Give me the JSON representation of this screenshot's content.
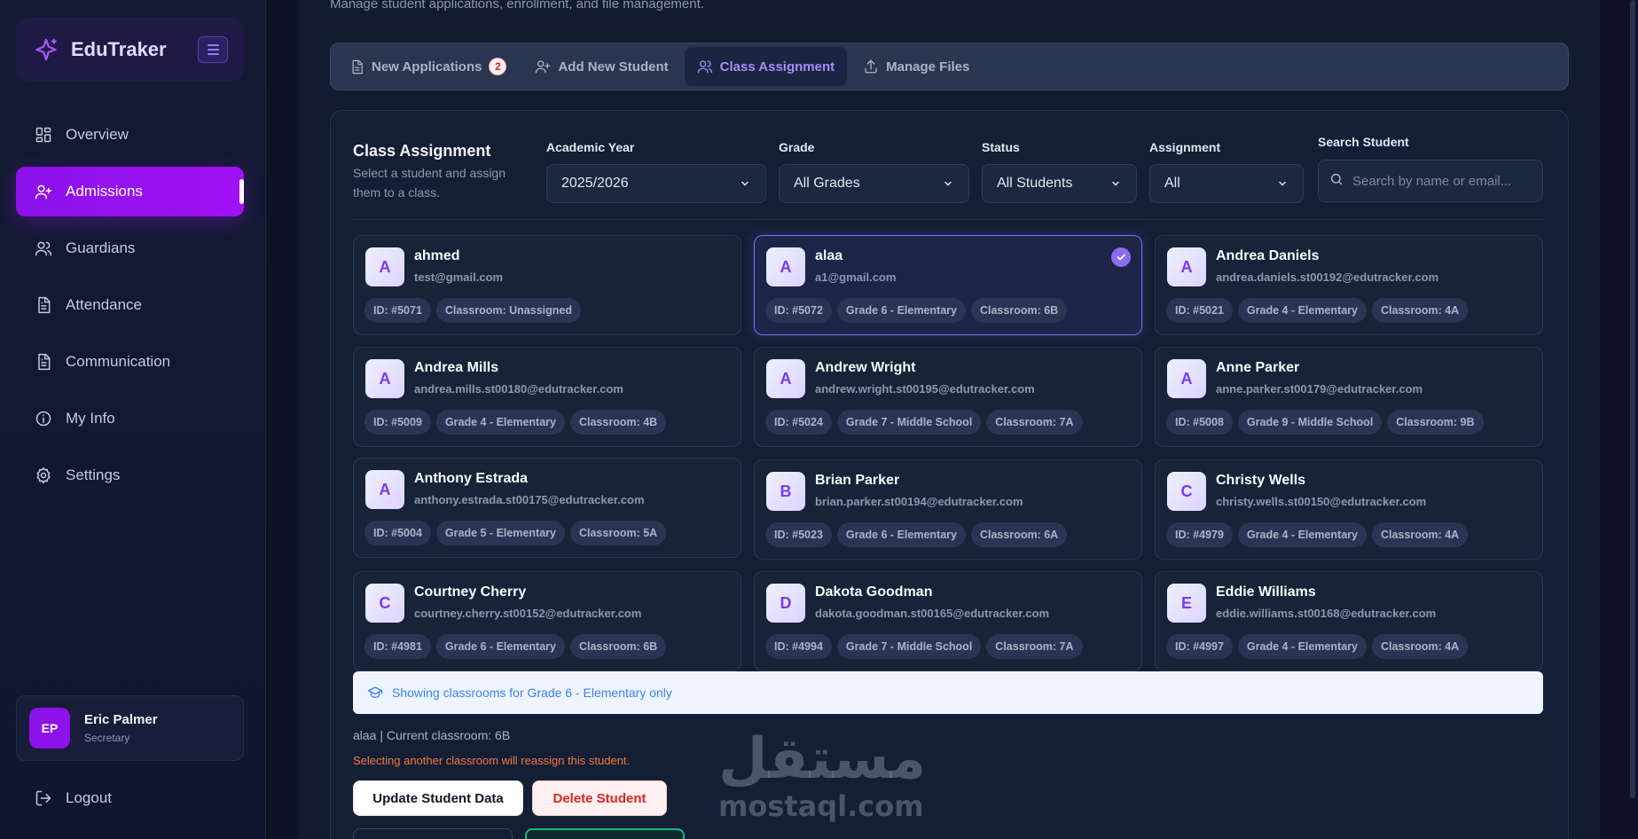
{
  "app": {
    "name": "EduTraker",
    "subtitle": "Manage student applications, enrollment, and file management."
  },
  "colors": {
    "accent": "#a111f5",
    "selected_border": "#7c6cf0",
    "danger": "#dc2626",
    "info": "#3b82f6",
    "warning": "#f07a3c"
  },
  "sidebar": {
    "items": [
      {
        "label": "Overview",
        "icon": "grid-icon"
      },
      {
        "label": "Admissions",
        "icon": "user-plus-icon"
      },
      {
        "label": "Guardians",
        "icon": "users-icon"
      },
      {
        "label": "Attendance",
        "icon": "document-icon"
      },
      {
        "label": "Communication",
        "icon": "document-icon"
      },
      {
        "label": "My Info",
        "icon": "info-icon"
      },
      {
        "label": "Settings",
        "icon": "gear-icon"
      }
    ],
    "user": {
      "initials": "EP",
      "name": "Eric Palmer",
      "role": "Secretary"
    },
    "logout": "Logout"
  },
  "tabs": [
    {
      "label": "New Applications",
      "badge": "2"
    },
    {
      "label": "Add New Student"
    },
    {
      "label": "Class Assignment"
    },
    {
      "label": "Manage Files"
    }
  ],
  "panel": {
    "title": "Class Assignment",
    "description": "Select a student and assign them to a class.",
    "filters": {
      "year": {
        "label": "Academic Year",
        "value": "2025/2026"
      },
      "grade": {
        "label": "Grade",
        "value": "All Grades"
      },
      "status": {
        "label": "Status",
        "value": "All Students"
      },
      "assignment": {
        "label": "Assignment",
        "value": "All"
      },
      "search": {
        "label": "Search Student",
        "placeholder": "Search by name or email..."
      }
    }
  },
  "students": [
    {
      "initial": "A",
      "name": "ahmed",
      "email": "test@gmail.com",
      "id": "ID: #5071",
      "classroom": "Classroom: Unassigned"
    },
    {
      "initial": "A",
      "name": "alaa",
      "email": "a1@gmail.com",
      "id": "ID: #5072",
      "grade": "Grade 6 - Elementary",
      "classroom": "Classroom: 6B"
    },
    {
      "initial": "A",
      "name": "Andrea Daniels",
      "email": "andrea.daniels.st00192@edutracker.com",
      "id": "ID: #5021",
      "grade": "Grade 4 - Elementary",
      "classroom": "Classroom: 4A"
    },
    {
      "initial": "A",
      "name": "Andrea Mills",
      "email": "andrea.mills.st00180@edutracker.com",
      "id": "ID: #5009",
      "grade": "Grade 4 - Elementary",
      "classroom": "Classroom: 4B"
    },
    {
      "initial": "A",
      "name": "Andrew Wright",
      "email": "andrew.wright.st00195@edutracker.com",
      "id": "ID: #5024",
      "grade": "Grade 7 - Middle School",
      "classroom": "Classroom: 7A"
    },
    {
      "initial": "A",
      "name": "Anne Parker",
      "email": "anne.parker.st00179@edutracker.com",
      "id": "ID: #5008",
      "grade": "Grade 9 - Middle School",
      "classroom": "Classroom: 9B"
    },
    {
      "initial": "A",
      "name": "Anthony Estrada",
      "email": "anthony.estrada.st00175@edutracker.com",
      "id": "ID: #5004",
      "grade": "Grade 5 - Elementary",
      "classroom": "Classroom: 5A"
    },
    {
      "initial": "B",
      "name": "Brian Parker",
      "email": "brian.parker.st00194@edutracker.com",
      "id": "ID: #5023",
      "grade": "Grade 6 - Elementary",
      "classroom": "Classroom: 6A"
    },
    {
      "initial": "C",
      "name": "Christy Wells",
      "email": "christy.wells.st00150@edutracker.com",
      "id": "ID: #4979",
      "grade": "Grade 4 - Elementary",
      "classroom": "Classroom: 4A"
    },
    {
      "initial": "C",
      "name": "Courtney Cherry",
      "email": "courtney.cherry.st00152@edutracker.com",
      "id": "ID: #4981",
      "grade": "Grade 6 - Elementary",
      "classroom": "Classroom: 6B"
    },
    {
      "initial": "D",
      "name": "Dakota Goodman",
      "email": "dakota.goodman.st00165@edutracker.com",
      "id": "ID: #4994",
      "grade": "Grade 7 - Middle School",
      "classroom": "Classroom: 7A"
    },
    {
      "initial": "E",
      "name": "Eddie Williams",
      "email": "eddie.williams.st00168@edutracker.com",
      "id": "ID: #4997",
      "grade": "Grade 4 - Elementary",
      "classroom": "Classroom: 4A"
    }
  ],
  "info_bar": "Showing classrooms for Grade 6 - Elementary only",
  "current_classroom": "alaa | Current classroom: 6B",
  "warning": "Selecting another classroom will reassign this student.",
  "buttons": {
    "update": "Update Student Data",
    "delete": "Delete Student"
  },
  "watermark": {
    "arabic": "مستقل",
    "latin": "mostaql.com"
  }
}
